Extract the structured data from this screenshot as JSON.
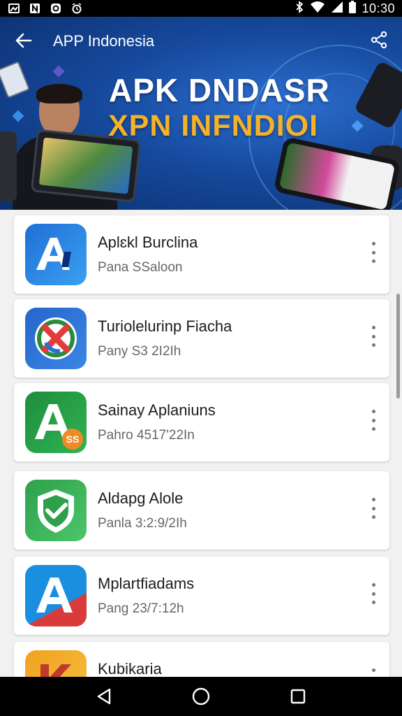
{
  "status_bar": {
    "time": "10:30",
    "left_icons": [
      "image-icon",
      "n-icon",
      "sync-icon",
      "alarm-icon"
    ],
    "right_icons": [
      "bluetooth-icon",
      "wifi-icon",
      "signal-icon",
      "battery-icon"
    ]
  },
  "header": {
    "title": "APP Indonesia",
    "banner_line1": "APK DNDASR",
    "banner_line2": "XPN INFNDIOI"
  },
  "apps": [
    {
      "name": "Aplɛkl Burclina",
      "subtitle": "Pana SSaloon",
      "icon_colors": [
        "#1f6fd6",
        "#3aa0f0"
      ],
      "icon_letter": "A"
    },
    {
      "name": "Turiolelurinp Fiacha",
      "subtitle": "Pany S3 2I2Ih",
      "icon_colors": [
        "#2566c9",
        "#3b86e6"
      ],
      "icon_letter": ""
    },
    {
      "name": "Sainay Aplaniuns",
      "subtitle": "Pahro 4517'22In",
      "icon_colors": [
        "#1f8d3c",
        "#2fb354"
      ],
      "icon_letter": "A",
      "badge": "SS"
    },
    {
      "name": "Aldapg Alole",
      "subtitle": "Panla 3:2:9/2Ih",
      "icon_colors": [
        "#2ea04b",
        "#4cc66a"
      ],
      "icon_letter": ""
    },
    {
      "name": "Mplartfiadams",
      "subtitle": "Pang 23/7:12h",
      "icon_colors": [
        "#1a8fe0",
        "#d93a3a"
      ],
      "icon_letter": "A"
    },
    {
      "name": "Kubikaria",
      "subtitle": "",
      "icon_colors": [
        "#f0a21f",
        "#f5c041"
      ],
      "icon_letter": "K"
    }
  ],
  "colors": {
    "banner_text_primary": "#ffffff",
    "banner_text_accent": "#f3b22a",
    "background": "#f1f1f1"
  },
  "nav": [
    "back-triangle-icon",
    "home-circle-icon",
    "recents-square-icon"
  ]
}
